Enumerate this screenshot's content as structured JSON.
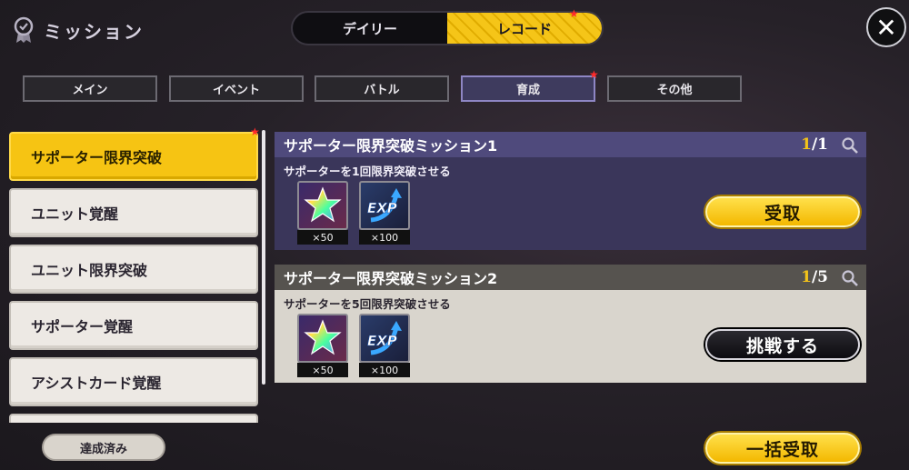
{
  "header": {
    "title": "ミッション"
  },
  "main_tabs": [
    {
      "label": "デイリー",
      "active": false
    },
    {
      "label": "レコード",
      "active": true
    }
  ],
  "close_label": "✕",
  "category_tabs": [
    {
      "label": "メイン",
      "active": false
    },
    {
      "label": "イベント",
      "active": false
    },
    {
      "label": "バトル",
      "active": false
    },
    {
      "label": "育成",
      "active": true
    },
    {
      "label": "その他",
      "active": false
    }
  ],
  "sidebar": {
    "items": [
      {
        "label": "サポーター限界突破",
        "active": true
      },
      {
        "label": "ユニット覚醒",
        "active": false
      },
      {
        "label": "ユニット限界突破",
        "active": false
      },
      {
        "label": "サポーター覚醒",
        "active": false
      },
      {
        "label": "アシストカード覚醒",
        "active": false
      }
    ]
  },
  "completed_button": "達成済み",
  "missions": [
    {
      "title": "サポーター限界突破ミッション1",
      "progress_current": "1",
      "progress_sep": "/",
      "progress_total": "1",
      "description": "サポーターを1回限界突破させる",
      "rewards": [
        {
          "icon": "rainbow-star-icon",
          "count": "×50"
        },
        {
          "icon": "exp-icon",
          "count": "×100"
        }
      ],
      "button_label": "受取",
      "button_style": "yellow"
    },
    {
      "title": "サポーター限界突破ミッション2",
      "progress_current": "1",
      "progress_sep": "/",
      "progress_total": "5",
      "description": "サポーターを5回限界突破させる",
      "rewards": [
        {
          "icon": "rainbow-star-icon",
          "count": "×50"
        },
        {
          "icon": "exp-icon",
          "count": "×100"
        }
      ],
      "button_label": "挑戦する",
      "button_style": "black"
    }
  ],
  "claim_all_button": "一括受取",
  "colors": {
    "accent": "#f6c413",
    "notice": "#ff2a2a",
    "active_category": "#3e3b5e"
  }
}
